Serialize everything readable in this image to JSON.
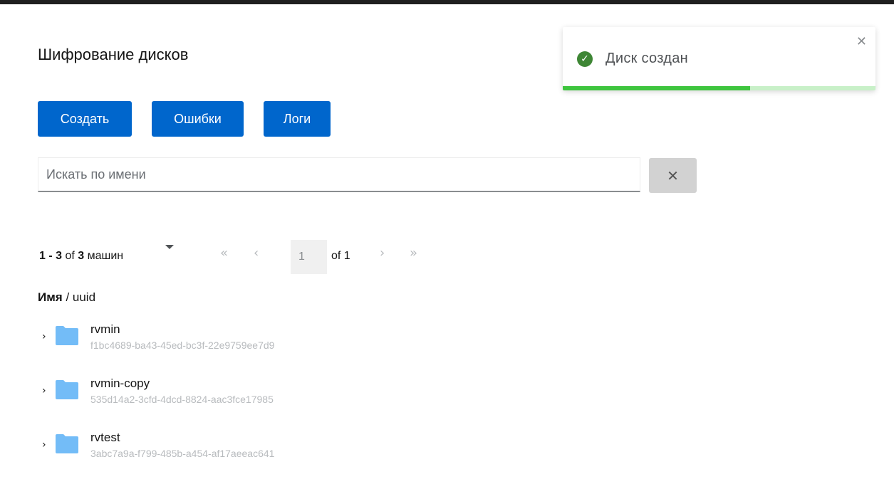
{
  "page": {
    "title": "Шифрование дисков"
  },
  "toolbar": {
    "create_label": "Создать",
    "errors_label": "Ошибки",
    "logs_label": "Логи"
  },
  "search": {
    "placeholder": "Искать по имени",
    "value": "",
    "clear_icon": "close-icon"
  },
  "pagination": {
    "range": "1 - 3",
    "of_word": "of",
    "total": "3",
    "unit": "машин",
    "current_page": "1",
    "of_pages": "of 1",
    "icons": [
      "chevron-double-left-icon",
      "chevron-left-icon",
      "chevron-right-icon",
      "chevron-double-right-icon"
    ]
  },
  "table": {
    "header_bold": "Имя",
    "header_rest": " / uuid",
    "rows": [
      {
        "name": "rvmin",
        "uuid": "f1bc4689-ba43-45ed-bc3f-22e9759ee7d9",
        "icon": "folder-icon"
      },
      {
        "name": "rvmin-copy",
        "uuid": "535d14a2-3cfd-4dcd-8824-aac3fce17985",
        "icon": "folder-icon"
      },
      {
        "name": "rvtest",
        "uuid": "3abc7a9a-f799-485b-a454-af17aeeac641",
        "icon": "folder-icon"
      }
    ]
  },
  "toast": {
    "message": "Диск создан",
    "progress": 0.6,
    "status": "success"
  },
  "colors": {
    "primary": "#0066cc",
    "success": "#3e8635",
    "folder": "#73bcf7",
    "progress": "#3ec53e"
  }
}
